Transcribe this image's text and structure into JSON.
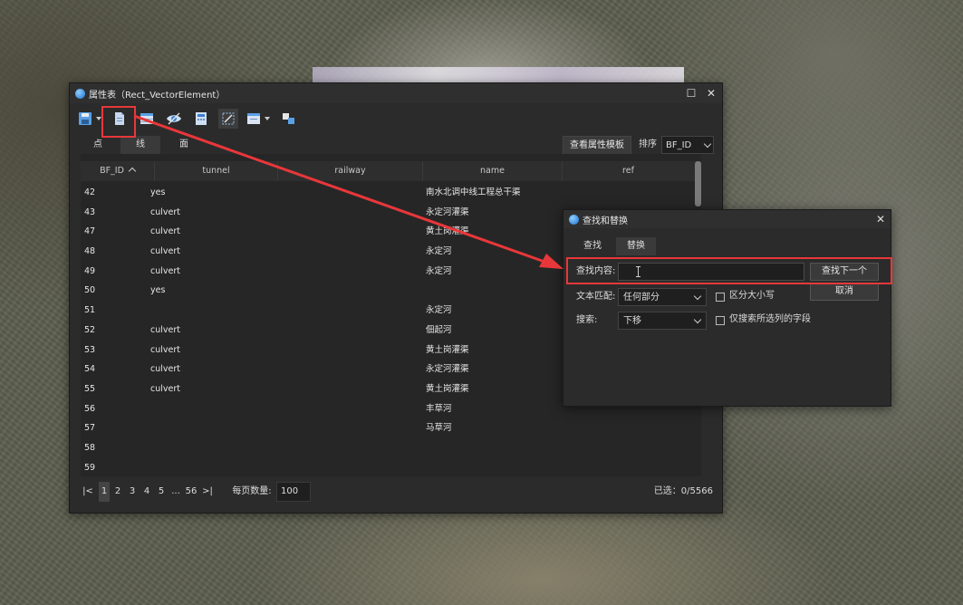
{
  "attr_window": {
    "title": "属性表（Rect_VectorElement）",
    "view_template_button": "查看属性模板",
    "sort_label": "排序",
    "sort_value": "BF_ID",
    "tabs": [
      "点",
      "线",
      "面"
    ],
    "active_tab": "线",
    "columns": [
      "BF_ID",
      "tunnel",
      "railway",
      "name",
      "ref"
    ],
    "rows": [
      {
        "id": "42",
        "tunnel": "yes",
        "name": "南水北调中线工程总干渠"
      },
      {
        "id": "43",
        "tunnel": "culvert",
        "name": "永定河灌渠"
      },
      {
        "id": "47",
        "tunnel": "culvert",
        "name": "黄土岗灌渠"
      },
      {
        "id": "48",
        "tunnel": "culvert",
        "name": "永定河"
      },
      {
        "id": "49",
        "tunnel": "culvert",
        "name": "永定河"
      },
      {
        "id": "50",
        "tunnel": "yes",
        "name": ""
      },
      {
        "id": "51",
        "tunnel": "",
        "name": "永定河"
      },
      {
        "id": "52",
        "tunnel": "culvert",
        "name": "佃起河"
      },
      {
        "id": "53",
        "tunnel": "culvert",
        "name": "黄土岗灌渠"
      },
      {
        "id": "54",
        "tunnel": "culvert",
        "name": "永定河灌渠"
      },
      {
        "id": "55",
        "tunnel": "culvert",
        "name": "黄土岗灌渠"
      },
      {
        "id": "56",
        "tunnel": "",
        "name": "丰草河"
      },
      {
        "id": "57",
        "tunnel": "",
        "name": "马草河"
      },
      {
        "id": "58",
        "tunnel": "",
        "name": ""
      },
      {
        "id": "59",
        "tunnel": "",
        "name": ""
      }
    ],
    "pager": {
      "pages": [
        "1",
        "2",
        "3",
        "4",
        "5",
        "...",
        "56"
      ],
      "per_page_label": "每页数量:",
      "per_page_value": "100",
      "selected_text": "已选：0/5566"
    }
  },
  "find_dialog": {
    "title": "查找和替换",
    "tabs": [
      "查找",
      "替换"
    ],
    "find_label": "查找内容:",
    "find_value": "",
    "find_next_button": "查找下一个",
    "cancel_button": "取消",
    "match_label": "文本匹配:",
    "match_value": "任何部分",
    "case_label": "区分大小写",
    "search_label": "搜索:",
    "search_value": "下移",
    "selected_fields_label": "仅搜索所选列的字段"
  },
  "colors": {
    "highlight": "#e8373a",
    "accent_blue": "#1e6fd0"
  }
}
